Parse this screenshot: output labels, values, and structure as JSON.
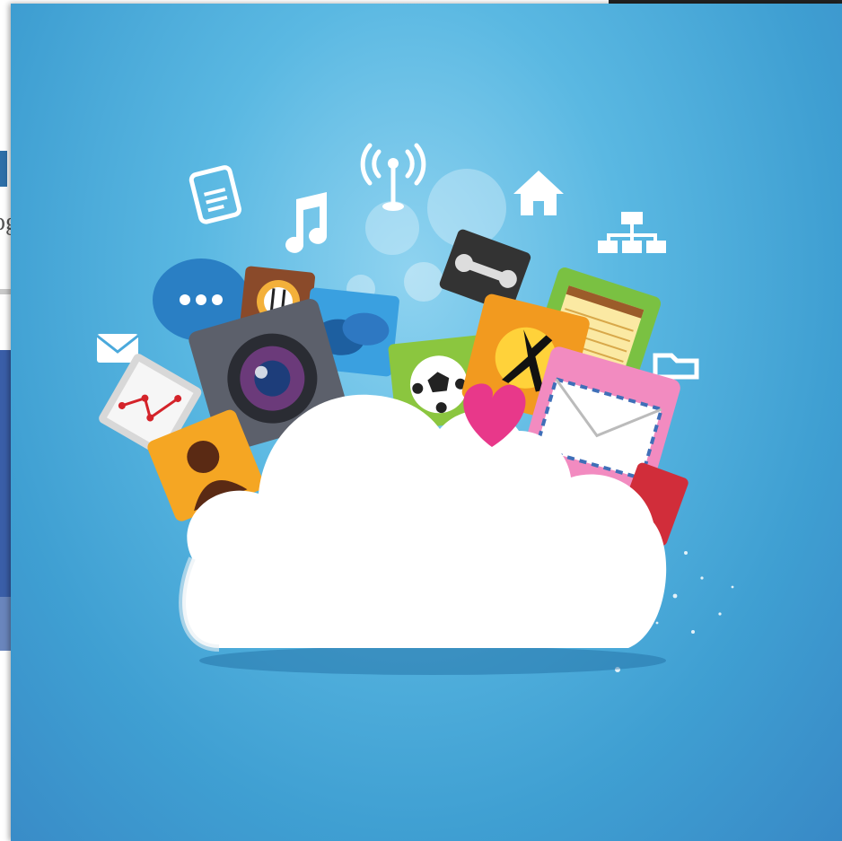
{
  "background": {
    "left_window_fragment": "og",
    "accent_color": "#3a5ea8"
  },
  "image": {
    "subject": "cloud-computing-apps",
    "colors": {
      "sky": "#4fb0e0",
      "cloud": "#ffffff",
      "heart": "#e8388a",
      "camera": "#555a66"
    },
    "icons": [
      "document-icon",
      "music-note-icon",
      "wifi-antenna-icon",
      "home-icon",
      "network-icon",
      "chat-bubble-icon",
      "mail-icon",
      "folder-icon",
      "restaurant-icon",
      "chat-icon",
      "wrench-icon",
      "notepad-icon",
      "map-icon",
      "camera-icon",
      "soccer-ball-icon",
      "dancer-icon",
      "envelope-icon",
      "contact-icon",
      "heart-icon"
    ]
  }
}
